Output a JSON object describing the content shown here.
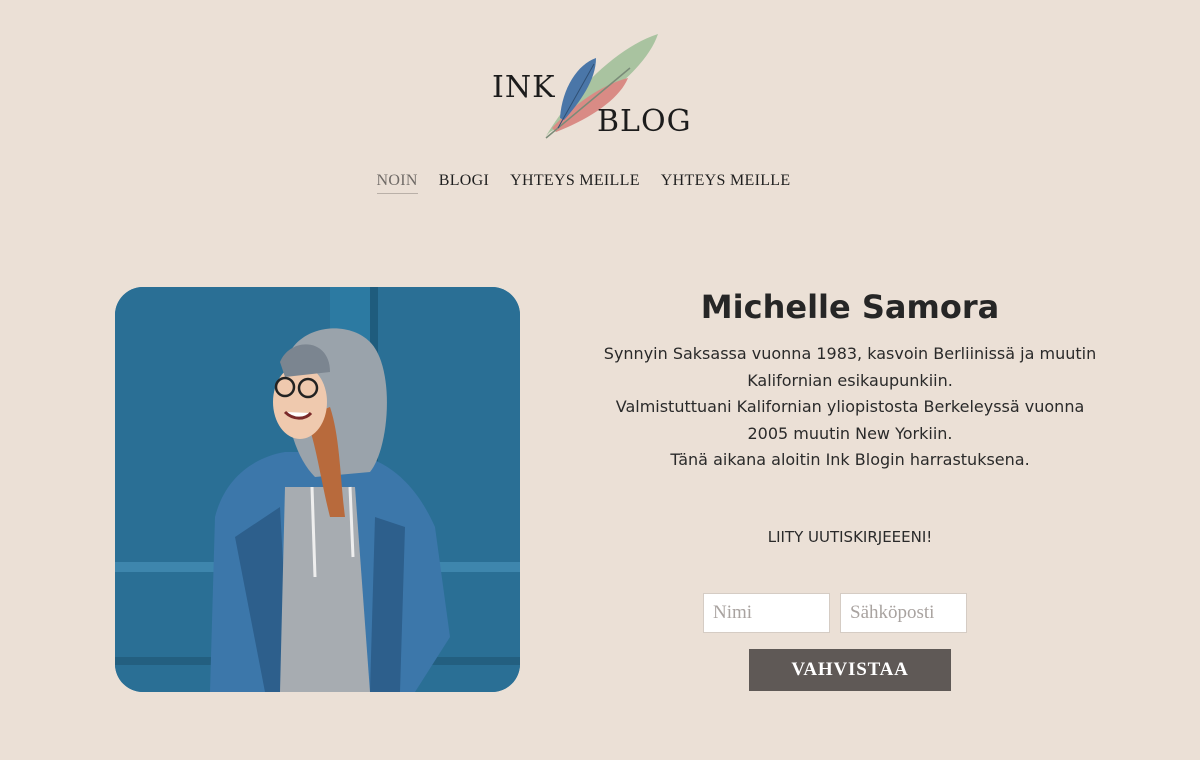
{
  "logo": {
    "line1": "INK",
    "line2": "BLOG",
    "icon": "feather-quills-icon"
  },
  "nav": {
    "items": [
      {
        "label": "NOIN",
        "active": true
      },
      {
        "label": "BLOGI",
        "active": false
      },
      {
        "label": "YHTEYS MEILLE",
        "active": false
      },
      {
        "label": "YHTEYS MEILLE",
        "active": false
      }
    ]
  },
  "profile": {
    "name": "Michelle Samora",
    "bio": [
      "Synnyin Saksassa vuonna 1983, kasvoin Berliinissä ja muutin Kalifornian esikaupunkiin.",
      "Valmistuttuani Kalifornian yliopistosta Berkeleyssä vuonna 2005 muutin New Yorkiin.",
      "Tänä aikana aloitin Ink Blogin harrastuksena."
    ]
  },
  "newsletter": {
    "title": "LIITY UUTISKIRJEEENI!",
    "name_placeholder": "Nimi",
    "email_placeholder": "Sähköposti",
    "submit_label": "VAHVISTAA"
  },
  "colors": {
    "background": "#ebe0d6",
    "button": "#5f5956",
    "feather_green": "#a9c3a0",
    "feather_red": "#d98b85",
    "feather_blue": "#4a76a8"
  }
}
